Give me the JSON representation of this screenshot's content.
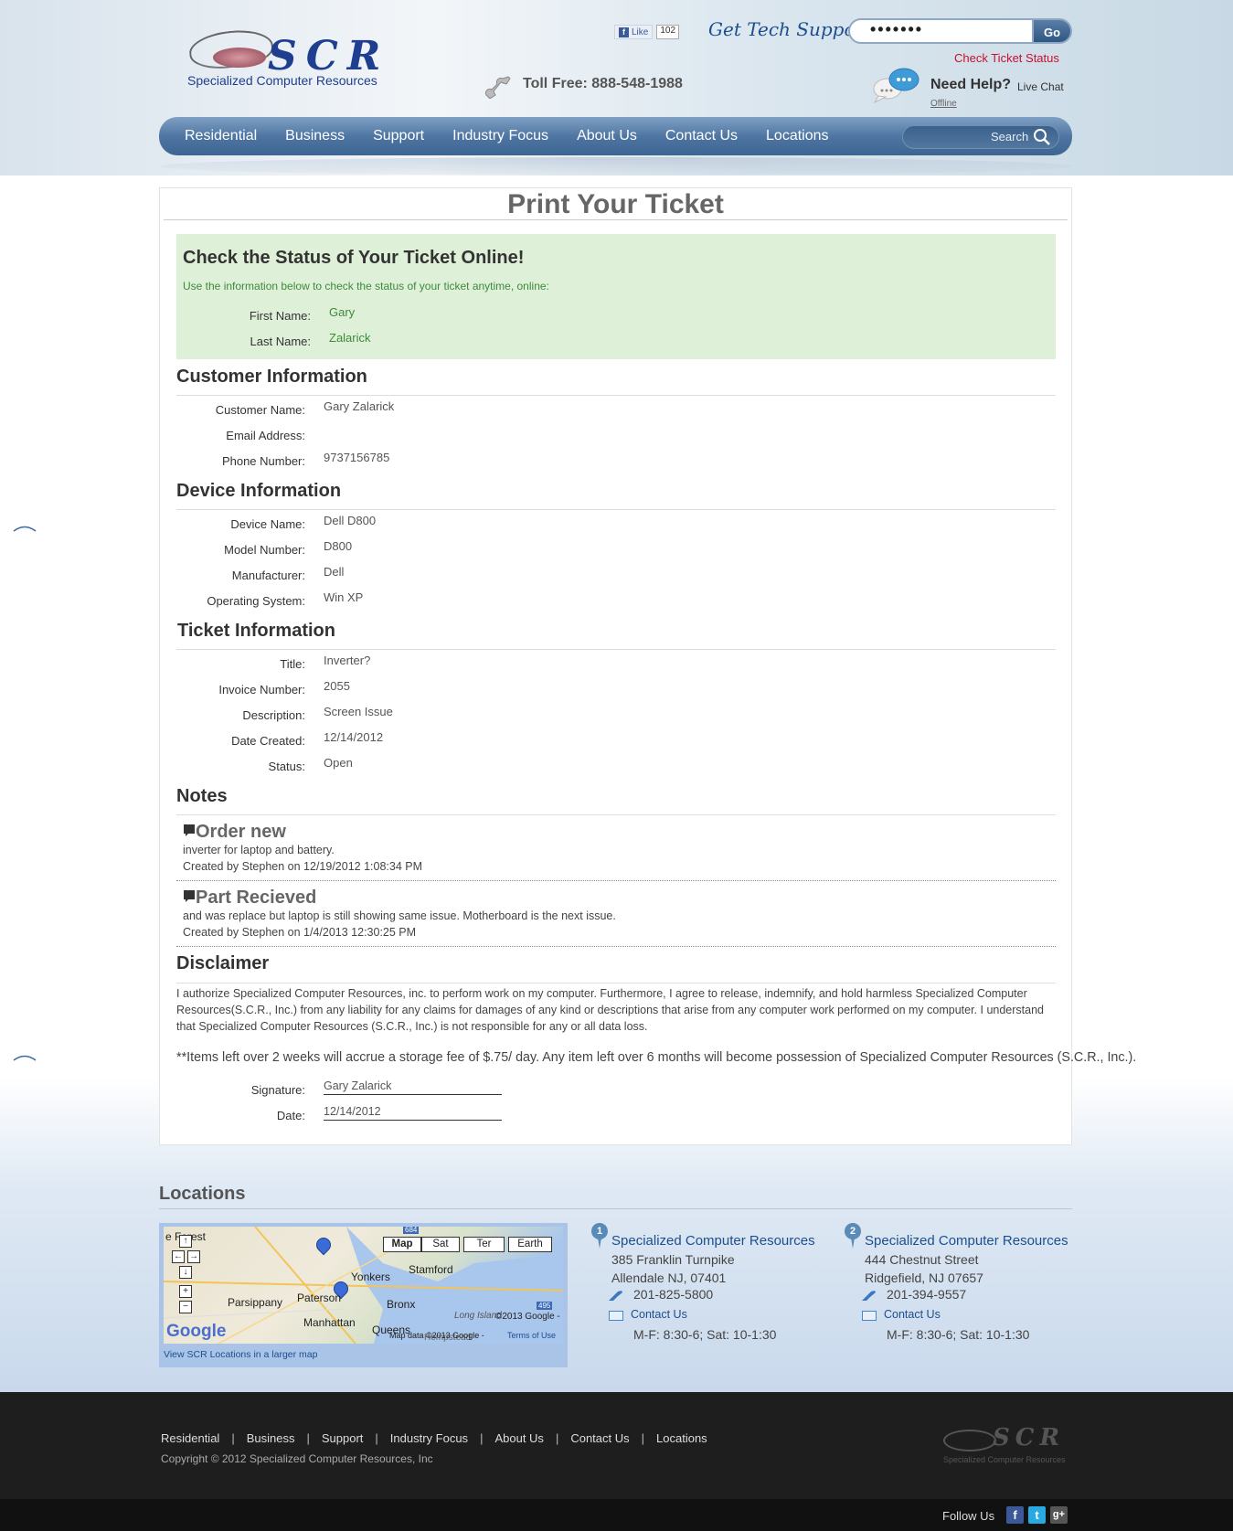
{
  "header": {
    "logo_text": "SCR",
    "logo_subtitle": "Specialized Computer Resources",
    "fb_like_label": "Like",
    "fb_like_count": "102",
    "tech_support_label": "Get Tech Support",
    "ticket_input_value": "•••••••",
    "go_label": "Go",
    "check_status_label": "Check Ticket Status",
    "toll_free": "Toll Free: 888-548-1988",
    "need_help": "Need Help?",
    "live_chat": "Live Chat",
    "chat_status": "Offline"
  },
  "nav": {
    "items": [
      "Residential",
      "Business",
      "Support",
      "Industry Focus",
      "About Us",
      "Contact Us",
      "Locations"
    ],
    "search_placeholder": "Search"
  },
  "page": {
    "title": "Print Your Ticket",
    "status_heading": "Check the Status of Your Ticket Online!",
    "status_desc": "Use the information below to check the status of your ticket anytime, online:",
    "first_name_label": "First Name:",
    "first_name": "Gary",
    "last_name_label": "Last Name:",
    "last_name": "Zalarick"
  },
  "customer": {
    "heading": "Customer Information",
    "name_label": "Customer Name:",
    "name": "Gary Zalarick",
    "email_label": "Email Address:",
    "email": "",
    "phone_label": "Phone Number:",
    "phone": "9737156785"
  },
  "device": {
    "heading": "Device Information",
    "name_label": "Device Name:",
    "name": "Dell D800",
    "model_label": "Model Number:",
    "model": "D800",
    "manufacturer_label": "Manufacturer:",
    "manufacturer": "Dell",
    "os_label": "Operating System:",
    "os": "Win XP"
  },
  "ticket": {
    "heading": "Ticket Information",
    "title_label": "Title:",
    "title": "Inverter?",
    "invoice_label": "Invoice Number:",
    "invoice": "2055",
    "description_label": "Description:",
    "description": "Screen Issue",
    "date_label": "Date Created:",
    "date": "12/14/2012",
    "status_label": "Status:",
    "status": "Open"
  },
  "notes": {
    "heading": "Notes",
    "items": [
      {
        "title": "Order new",
        "text": "inverter for laptop and battery.",
        "meta": "Created by Stephen on 12/19/2012 1:08:34 PM"
      },
      {
        "title": "Part Recieved",
        "text": "and was replace but laptop is still showing same issue. Motherboard is the next issue.",
        "meta": "Created by Stephen on 1/4/2013 12:30:25 PM"
      }
    ]
  },
  "disclaimer": {
    "heading": "Disclaimer",
    "text": "I authorize Specialized Computer Resources, inc. to perform work on my computer. Furthermore, I agree to release, indemnify, and hold harmless Specialized Computer Resources(S.C.R., Inc.) from any liability for any claims for damages of any kind or descriptions that arise from any computer work performed on my computer. I understand that Specialized Computer Resources (S.C.R., Inc.) is not responsible for any or all data loss.",
    "storage_note": "**Items left over 2 weeks will accrue a storage fee of $.75/ day. Any item left over 6 months will become possession of Specialized Computer Resources (S.C.R., Inc.).",
    "signature_label": "Signature:",
    "signature": "Gary Zalarick",
    "date_label": "Date:",
    "date": "12/14/2012"
  },
  "locations": {
    "heading": "Locations",
    "map": {
      "types": [
        "Map",
        "Sat",
        "Ter",
        "Earth"
      ],
      "selected_type": "Map",
      "labels": [
        "e Forest",
        "Yonkers",
        "Stamford",
        "Parsippany",
        "Paterson",
        "Bronx",
        "Manhattan",
        "Queens",
        "Long Island",
        "Hempstead",
        "684",
        "495"
      ],
      "copyright": "©2013 Google -",
      "data_credit": "Map data ©2013 Google -",
      "terms": "Terms of Use",
      "brand": "Google",
      "view_larger": "View SCR Locations in a larger map"
    },
    "items": [
      {
        "num": "1",
        "name": "Specialized Computer Resources",
        "street": "385 Franklin Turnpike",
        "city": "Allendale NJ, 07401",
        "phone": "201-825-5800",
        "contact": "Contact Us",
        "hours": "M-F: 8:30-6; Sat: 10-1:30"
      },
      {
        "num": "2",
        "name": "Specialized Computer Resources",
        "street": "444 Chestnut Street",
        "city": "Ridgefield, NJ 07657",
        "phone": "201-394-9557",
        "contact": "Contact Us",
        "hours": "M-F: 8:30-6; Sat: 10-1:30"
      }
    ]
  },
  "footer": {
    "nav": [
      "Residential",
      "Business",
      "Support",
      "Industry Focus",
      "About Us",
      "Contact Us",
      "Locations"
    ],
    "copyright": "Copyright © 2012 Specialized Computer Resources, Inc",
    "logo_text": "SCR",
    "logo_subtitle": "Specialized Computer Resources",
    "follow_label": "Follow Us",
    "social": [
      "f",
      "t",
      "g+"
    ]
  },
  "colors": {
    "nav_blue": "#4f76a2",
    "status_green_bg": "#dff0d8",
    "status_green_text": "#3c8b3c",
    "alert_red": "#c8102e",
    "link_blue": "#1c4f8e",
    "footer_bg": "#1e1e1e"
  }
}
